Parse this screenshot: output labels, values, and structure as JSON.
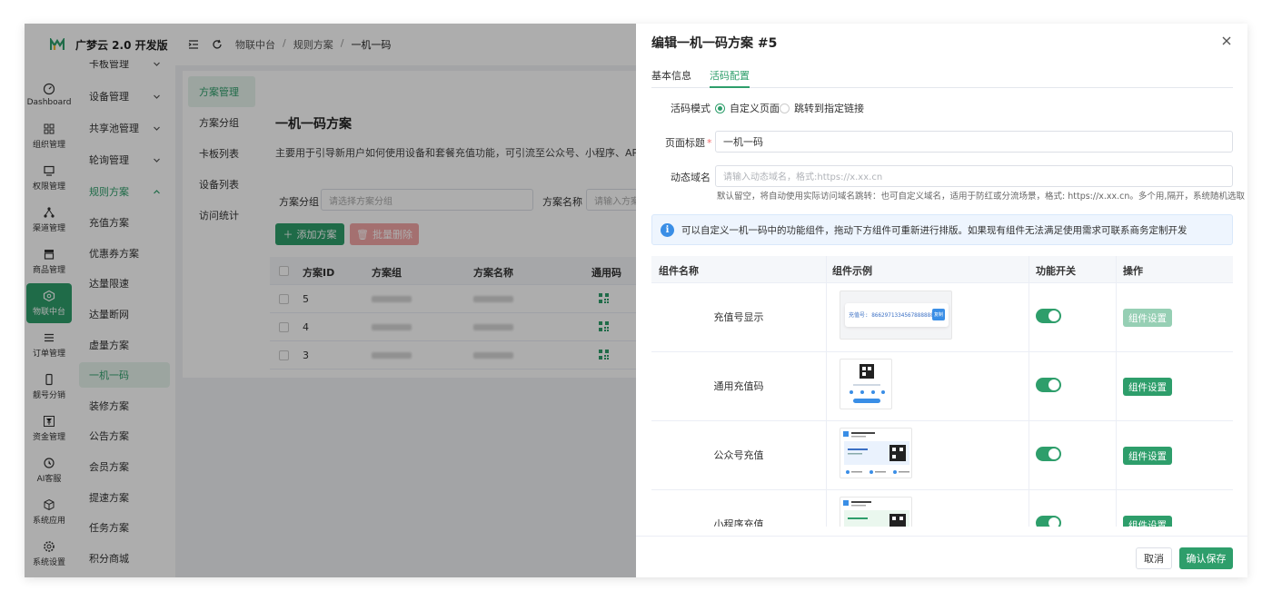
{
  "app": {
    "brand": "广梦云 2.0 开发版"
  },
  "rail": {
    "items": [
      {
        "label": "Dashboard",
        "icon": "gauge-icon"
      },
      {
        "label": "组织管理",
        "icon": "grid-icon"
      },
      {
        "label": "权限管理",
        "icon": "monitor-icon"
      },
      {
        "label": "渠道管理",
        "icon": "network-icon"
      },
      {
        "label": "商品管理",
        "icon": "store-icon"
      },
      {
        "label": "物联中台",
        "icon": "iot-icon"
      },
      {
        "label": "订单管理",
        "icon": "list-icon"
      },
      {
        "label": "靓号分销",
        "icon": "phone-icon"
      },
      {
        "label": "资金管理",
        "icon": "yen-icon"
      },
      {
        "label": "AI客服",
        "icon": "chat-icon"
      },
      {
        "label": "系统应用",
        "icon": "cube-icon"
      },
      {
        "label": "系统设置",
        "icon": "gear-icon"
      }
    ]
  },
  "subnav": {
    "items": [
      "卡板管理",
      "设备管理",
      "共享池管理",
      "轮询管理",
      "规则方案",
      "充值方案",
      "优惠券方案",
      "达量限速",
      "达量断网",
      "虚量方案",
      "一机一码",
      "装修方案",
      "公告方案",
      "会员方案",
      "提速方案",
      "任务方案",
      "积分商城"
    ]
  },
  "breadcrumb": [
    "物联中台",
    "规则方案",
    "一机一码"
  ],
  "page": {
    "tabs": [
      "方案管理",
      "方案分组",
      "卡板列表",
      "设备列表",
      "访问统计"
    ],
    "title": "一机一码方案",
    "desc": "主要用于引导新用户如何使用设备和套餐充值功能，可引流至公众号、小程序、APP、自定义",
    "group_label": "方案分组",
    "group_placeholder": "请选择方案分组",
    "name_label": "方案名称",
    "name_placeholder": "请输入方案名称",
    "add_btn": "添加方案",
    "del_btn": "批量删除",
    "table_head": [
      "方案ID",
      "方案组",
      "方案名称",
      "通用码"
    ],
    "rows": [
      {
        "id": "5"
      },
      {
        "id": "4"
      },
      {
        "id": "3"
      }
    ]
  },
  "drawer": {
    "title": "编辑一机一码方案 #5",
    "tabs": [
      "基本信息",
      "活码配置"
    ],
    "mode_label": "活码模式",
    "mode_opt1": "自定义页面",
    "mode_opt2": "跳转到指定链接",
    "page_title_label": "页面标题",
    "page_title_value": "一机一码",
    "domain_label": "动态域名",
    "domain_placeholder": "请输入动态域名，格式:https://x.xx.cn",
    "domain_hint": "默认留空，将自动使用实际访问域名跳转：也可自定义域名，适用于防红或分流场景，格式: https://x.xx.cn。多个用,隔开，系统随机选取",
    "alert": "可以自定义一机一码中的功能组件，拖动下方组件可重新进行排版。如果现有组件无法满足使用需求可联系商务定制开发",
    "comp_head": [
      "组件名称",
      "组件示例",
      "功能开关",
      "操作"
    ],
    "components": [
      {
        "name": "充值号显示",
        "sample_text": "充值号: 8662971334567888888",
        "sample_btn": "复制",
        "enabled": true,
        "action": "组件设置",
        "action_disabled": true
      },
      {
        "name": "通用充值码",
        "enabled": true,
        "action": "组件设置",
        "action_disabled": false
      },
      {
        "name": "公众号充值",
        "enabled": true,
        "action": "组件设置",
        "action_disabled": false
      },
      {
        "name": "小程序充值",
        "enabled": true,
        "action": "组件设置",
        "action_disabled": false
      }
    ],
    "cancel": "取消",
    "save": "确认保存"
  },
  "colors": {
    "accent": "#2e9e6b",
    "danger": "#f56c6c",
    "info": "#3a8ee6"
  }
}
